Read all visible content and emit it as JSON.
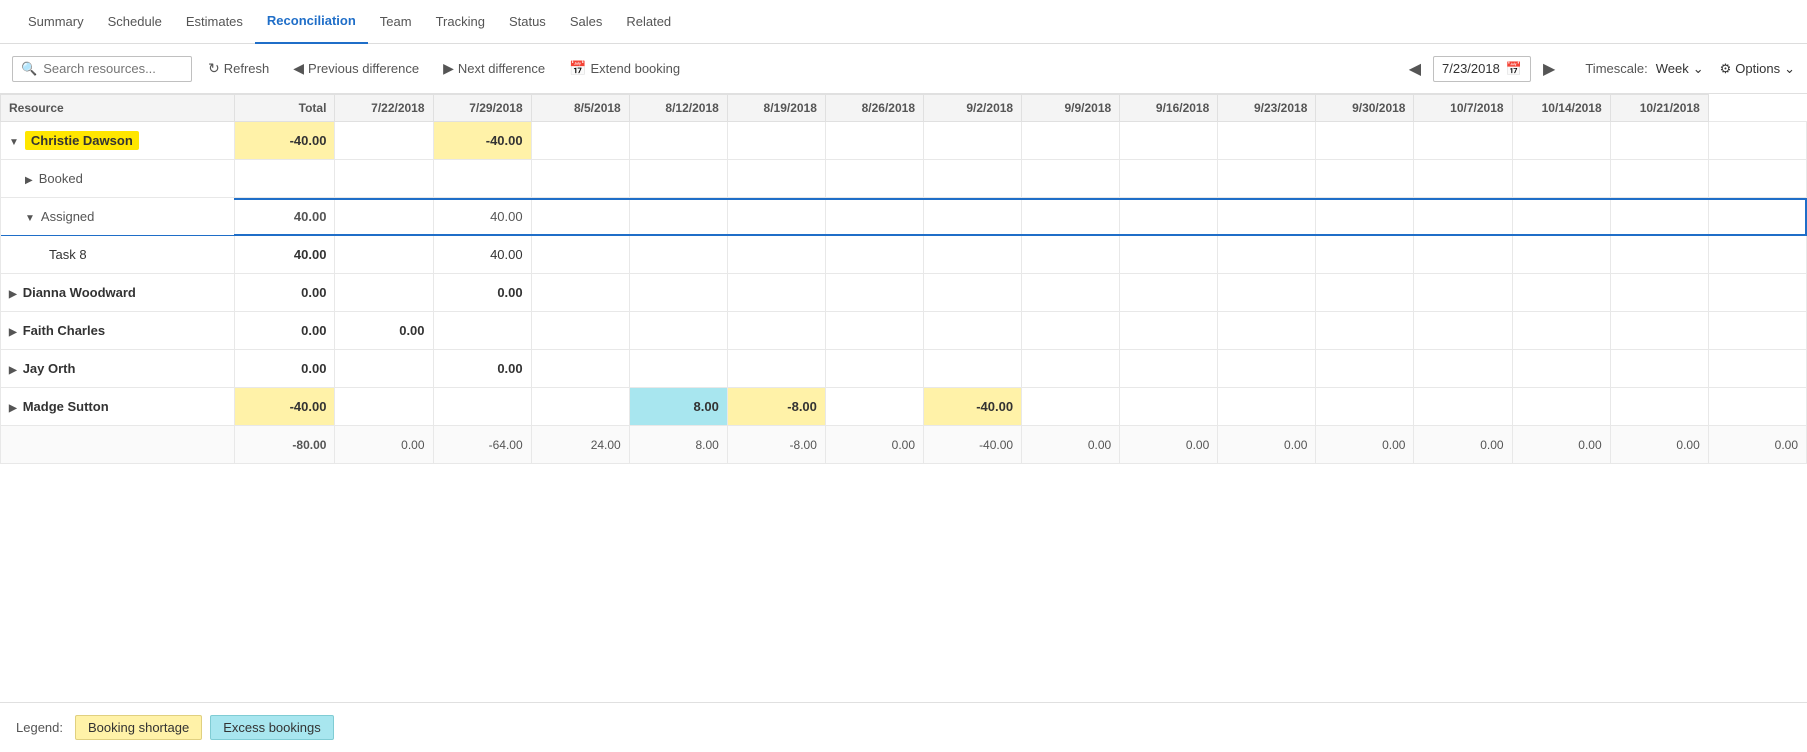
{
  "nav": {
    "items": [
      {
        "label": "Summary",
        "active": false
      },
      {
        "label": "Schedule",
        "active": false
      },
      {
        "label": "Estimates",
        "active": false
      },
      {
        "label": "Reconciliation",
        "active": true
      },
      {
        "label": "Team",
        "active": false
      },
      {
        "label": "Tracking",
        "active": false
      },
      {
        "label": "Status",
        "active": false
      },
      {
        "label": "Sales",
        "active": false
      },
      {
        "label": "Related",
        "active": false
      }
    ]
  },
  "toolbar": {
    "search_placeholder": "Search resources...",
    "refresh_label": "Refresh",
    "prev_diff_label": "Previous difference",
    "next_diff_label": "Next difference",
    "extend_label": "Extend booking",
    "date_value": "7/23/2018",
    "timescale_label": "Timescale:",
    "timescale_value": "Week",
    "options_label": "Options"
  },
  "grid": {
    "headers": [
      "Resource",
      "Total",
      "7/22/2018",
      "7/29/2018",
      "8/5/2018",
      "8/12/2018",
      "8/19/2018",
      "8/26/2018",
      "9/2/2018",
      "9/9/2018",
      "9/16/2018",
      "9/23/2018",
      "9/30/2018",
      "10/7/2018",
      "10/14/2018",
      "10/21/2018"
    ],
    "rows": [
      {
        "type": "resource",
        "name": "Christie Dawson",
        "highlight": true,
        "expanded": true,
        "total": "-40.00",
        "cells": [
          "",
          "-40.00",
          "",
          "",
          "",
          "",
          "",
          "",
          "",
          "",
          "",
          "",
          "",
          "",
          ""
        ],
        "cell_types": [
          "",
          "shortage",
          "",
          "",
          "",
          "",
          "",
          "",
          "",
          "",
          "",
          "",
          "",
          "",
          ""
        ]
      },
      {
        "type": "sub",
        "name": "Booked",
        "expanded": false,
        "total": "",
        "cells": [
          "",
          "",
          "",
          "",
          "",
          "",
          "",
          "",
          "",
          "",
          "",
          "",
          "",
          "",
          ""
        ],
        "cell_types": [
          "",
          "",
          "",
          "",
          "",
          "",
          "",
          "",
          "",
          "",
          "",
          "",
          "",
          "",
          ""
        ]
      },
      {
        "type": "sub",
        "name": "Assigned",
        "highlight_row": true,
        "expanded": true,
        "total": "40.00",
        "cells": [
          "",
          "40.00",
          "",
          "",
          "",
          "",
          "",
          "",
          "",
          "",
          "",
          "",
          "",
          "",
          ""
        ],
        "cell_types": [
          "",
          "",
          "",
          "",
          "",
          "",
          "",
          "",
          "",
          "",
          "",
          "",
          "",
          "",
          ""
        ]
      },
      {
        "type": "task",
        "name": "Task 8",
        "total": "40.00",
        "cells": [
          "",
          "40.00",
          "",
          "",
          "",
          "",
          "",
          "",
          "",
          "",
          "",
          "",
          "",
          "",
          ""
        ],
        "cell_types": [
          "",
          "",
          "",
          "",
          "",
          "",
          "",
          "",
          "",
          "",
          "",
          "",
          "",
          "",
          ""
        ]
      },
      {
        "type": "resource",
        "name": "Dianna Woodward",
        "expanded": false,
        "total": "0.00",
        "cells": [
          "",
          "0.00",
          "",
          "",
          "",
          "",
          "",
          "",
          "",
          "",
          "",
          "",
          "",
          "",
          ""
        ],
        "cell_types": [
          "",
          "",
          "",
          "",
          "",
          "",
          "",
          "",
          "",
          "",
          "",
          "",
          "",
          "",
          ""
        ]
      },
      {
        "type": "resource",
        "name": "Faith Charles",
        "expanded": false,
        "total": "0.00",
        "cells": [
          "0.00",
          "",
          "",
          "",
          "",
          "",
          "",
          "",
          "",
          "",
          "",
          "",
          "",
          "",
          ""
        ],
        "cell_types": [
          "",
          "",
          "",
          "",
          "",
          "",
          "",
          "",
          "",
          "",
          "",
          "",
          "",
          "",
          ""
        ]
      },
      {
        "type": "resource",
        "name": "Jay Orth",
        "expanded": false,
        "total": "0.00",
        "cells": [
          "",
          "0.00",
          "",
          "",
          "",
          "",
          "",
          "",
          "",
          "",
          "",
          "",
          "",
          "",
          ""
        ],
        "cell_types": [
          "",
          "",
          "",
          "",
          "",
          "",
          "",
          "",
          "",
          "",
          "",
          "",
          "",
          "",
          ""
        ]
      },
      {
        "type": "resource",
        "name": "Madge Sutton",
        "expanded": false,
        "total": "-40.00",
        "cells": [
          "",
          "",
          "",
          "8.00",
          "-8.00",
          "",
          "-40.00",
          "",
          "",
          "",
          "",
          "",
          "",
          "",
          ""
        ],
        "cell_types": [
          "",
          "",
          "",
          "excess",
          "shortage",
          "",
          "shortage",
          "",
          "",
          "",
          "",
          "",
          "",
          "",
          ""
        ]
      },
      {
        "type": "total-row",
        "name": "",
        "total": "-80.00",
        "cells": [
          "0.00",
          "-64.00",
          "24.00",
          "8.00",
          "-8.00",
          "0.00",
          "-40.00",
          "0.00",
          "0.00",
          "0.00",
          "0.00",
          "0.00",
          "0.00",
          "0.00",
          "0.00"
        ],
        "cell_types": [
          "",
          "",
          "",
          "",
          "",
          "",
          "",
          "",
          "",
          "",
          "",
          "",
          "",
          "",
          ""
        ]
      }
    ]
  },
  "legend": {
    "label": "Legend:",
    "shortage_label": "Booking shortage",
    "excess_label": "Excess bookings"
  }
}
